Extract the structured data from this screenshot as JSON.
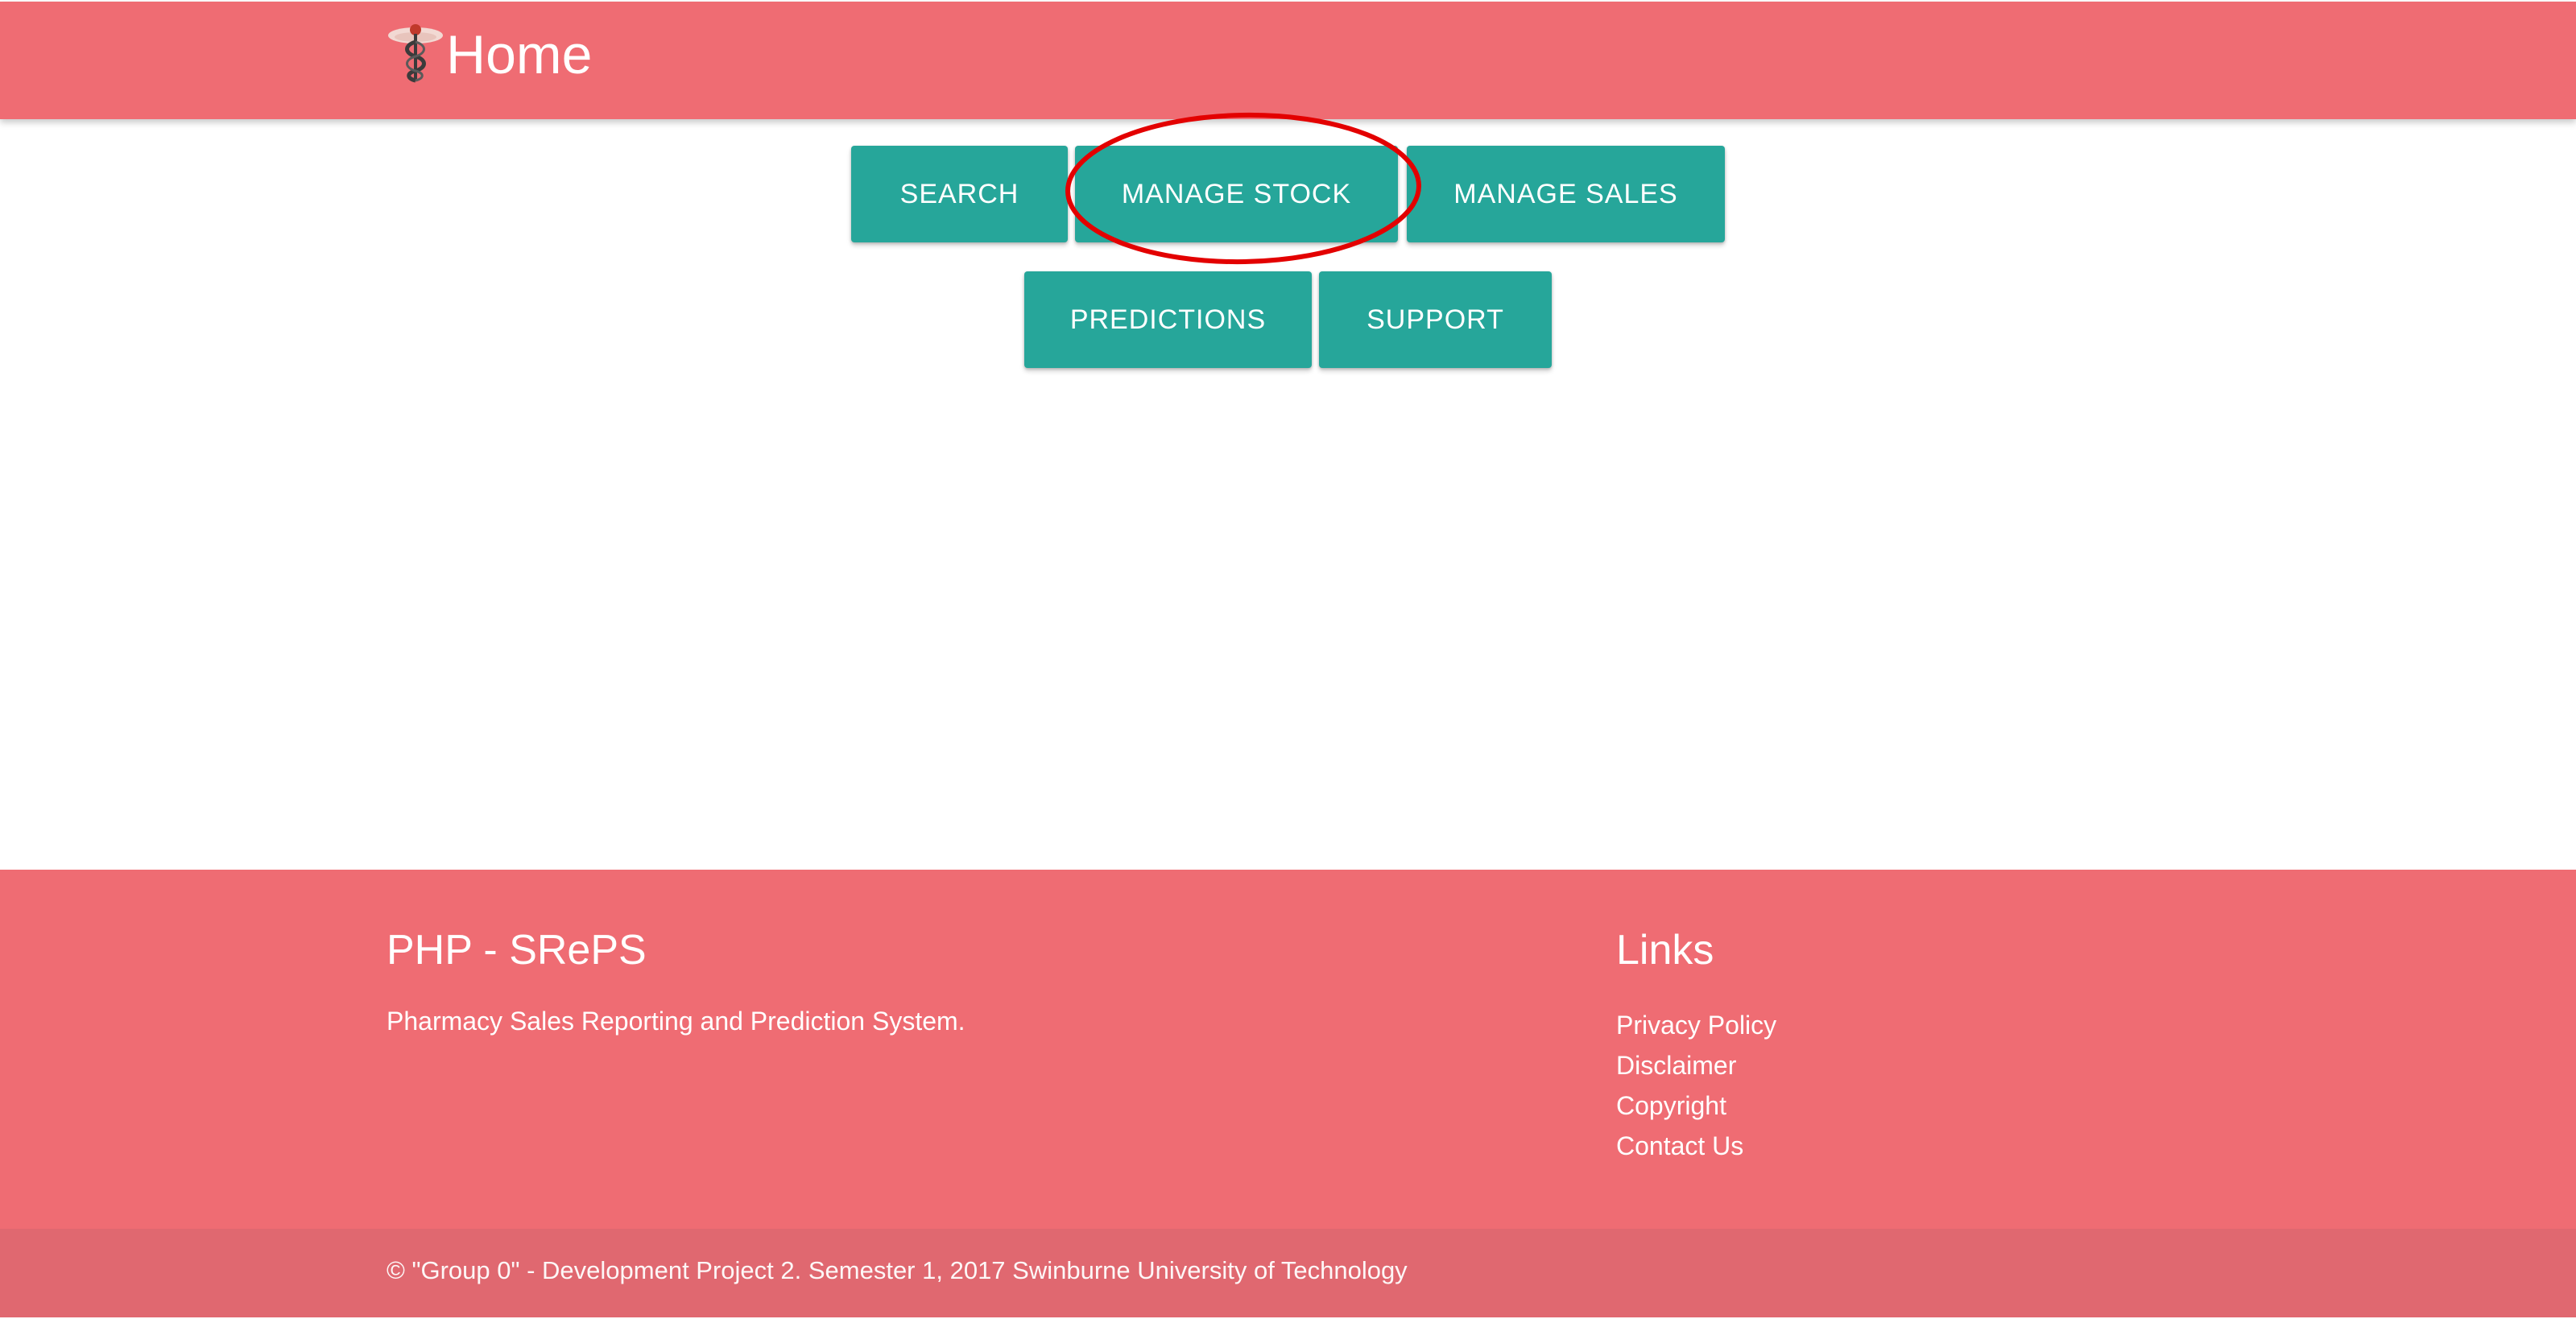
{
  "header": {
    "title": "Home",
    "logo_icon": "caduceus-icon",
    "background_color": "#ef6c73"
  },
  "nav_buttons": {
    "search": "SEARCH",
    "manage_stock": "MANAGE STOCK",
    "manage_sales": "MANAGE SALES",
    "predictions": "PREDICTIONS",
    "support": "SUPPORT",
    "button_color": "#26a69a",
    "highlighted": "MANAGE STOCK",
    "highlight_color": "#e30000"
  },
  "footer": {
    "title": "PHP - SRePS",
    "description": "Pharmacy Sales Reporting and Prediction System.",
    "links_title": "Links",
    "links": [
      "Privacy Policy",
      "Disclaimer",
      "Copyright",
      "Contact Us"
    ],
    "copyright": "© \"Group 0\" - Development Project 2. Semester 1, 2017 Swinburne University of Technology"
  }
}
